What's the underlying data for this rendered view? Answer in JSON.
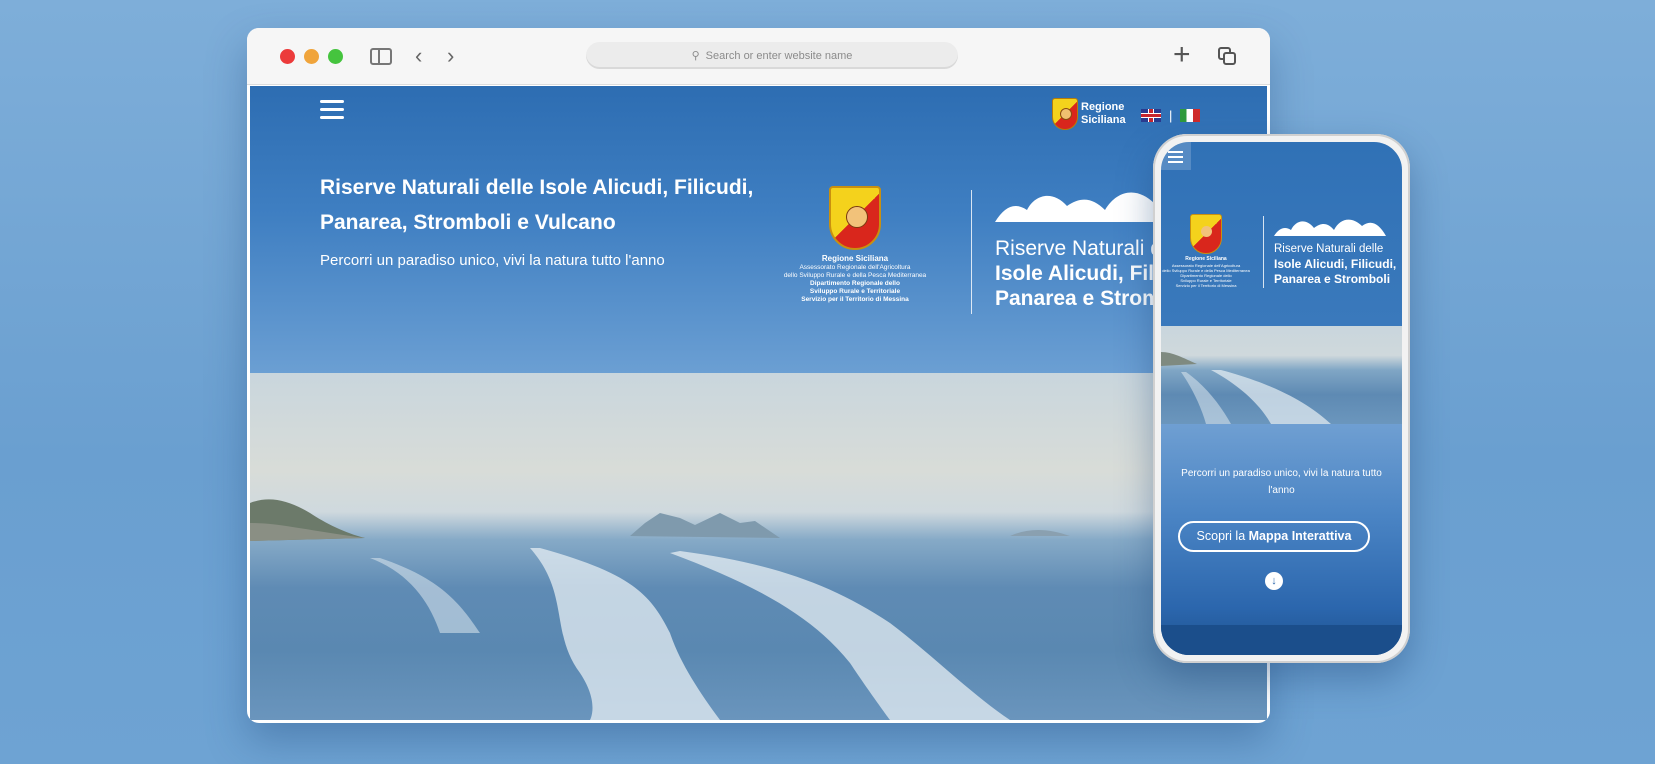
{
  "browser": {
    "address_placeholder": "Search or enter website name",
    "icons": [
      "sidebar-icon",
      "chevron-left-icon",
      "chevron-right-icon",
      "search-icon",
      "plus-icon",
      "tabs-icon"
    ]
  },
  "site": {
    "header": {
      "region_logo_text": "Regione\nSiciliana",
      "flag_separator": "|"
    },
    "hero": {
      "title": "Riserve Naturali delle Isole Alicudi, Filicudi, Panarea, Stromboli e Vulcano",
      "subtitle": "Percorri un paradiso unico, vivi la natura tutto l'anno"
    },
    "sicily_logo": {
      "name": "Regione Siciliana",
      "lines": [
        "Assessorato Regionale dell'Agricoltura",
        "dello Sviluppo Rurale e della Pesca Mediterranea",
        "Dipartimento Regionale dello",
        "Sviluppo Rurale e Territoriale",
        "Servizio per il Territorio di Messina"
      ]
    },
    "reserve_logo": {
      "line1": "Riserve Naturali d",
      "line2": "Isole Alicudi, Filic",
      "line3": "Panarea e Strom"
    }
  },
  "phone": {
    "reserve_logo": {
      "line1": "Riserve Naturali delle",
      "line2": "Isole Alicudi, Filicudi,",
      "line3": "Panarea e Stromboli"
    },
    "subtitle": "Percorri un paradiso unico, vivi la natura tutto l'anno",
    "cta_prefix": "Scopri la ",
    "cta_bold": "Mappa Interattiva"
  },
  "colors": {
    "background": "#6ea3d3",
    "hero_blue": "#2d6db2",
    "traffic_red": "#ec3b3b",
    "traffic_yellow": "#f0a43b",
    "traffic_green": "#45c43e"
  }
}
